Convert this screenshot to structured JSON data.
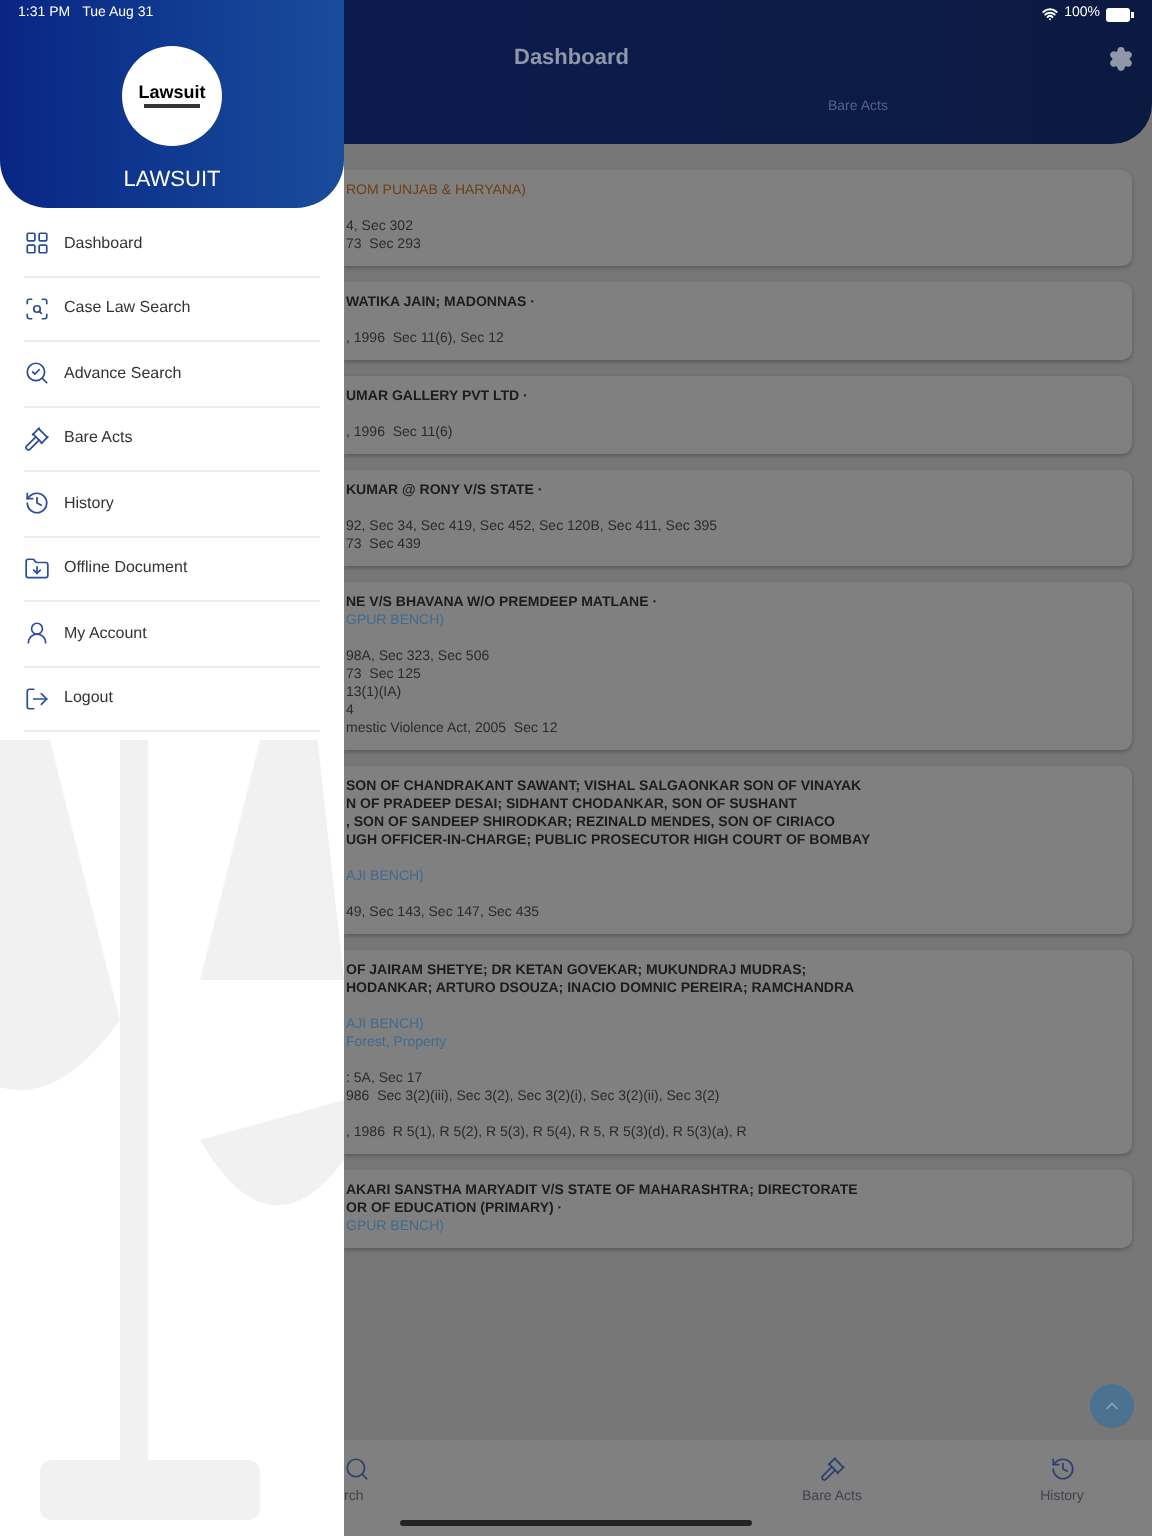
{
  "status_bar": {
    "time": "1:31 PM",
    "date": "Tue Aug 31",
    "battery": "100%"
  },
  "drawer": {
    "app_name": "LAWSUIT",
    "logo_text": "Lawsuit",
    "items": [
      {
        "label": "Dashboard"
      },
      {
        "label": "Case Law Search"
      },
      {
        "label": "Advance Search"
      },
      {
        "label": "Bare Acts"
      },
      {
        "label": "History"
      },
      {
        "label": "Offline Document"
      },
      {
        "label": "My Account"
      },
      {
        "label": "Logout"
      }
    ]
  },
  "header": {
    "title": "Dashboard",
    "tab": "Bare Acts"
  },
  "cards": [
    {
      "groups": [
        [
          {
            "kind": "court",
            "text": "ROM PUNJAB & HARYANA)",
            "color": "#6e4014"
          }
        ],
        [
          {
            "kind": "act",
            "text": "4, Sec 302"
          },
          {
            "kind": "act",
            "text": "73  Sec 293"
          }
        ]
      ]
    },
    {
      "groups": [
        [
          {
            "kind": "party",
            "text": "WATIKA JAIN; MADONNAS ·"
          }
        ],
        [
          {
            "kind": "act",
            "text": ", 1996  Sec 11(6), Sec 12"
          }
        ]
      ]
    },
    {
      "groups": [
        [
          {
            "kind": "party",
            "text": "UMAR GALLERY PVT LTD ·"
          }
        ],
        [
          {
            "kind": "act",
            "text": ", 1996  Sec 11(6)"
          }
        ]
      ]
    },
    {
      "groups": [
        [
          {
            "kind": "party",
            "text": "KUMAR @ RONY V/S STATE ·"
          }
        ],
        [
          {
            "kind": "act",
            "text": "92, Sec 34, Sec 419, Sec 452, Sec 120B, Sec 411, Sec 395"
          },
          {
            "kind": "act",
            "text": "73  Sec 439"
          }
        ]
      ]
    },
    {
      "groups": [
        [
          {
            "kind": "party",
            "text": "NE V/S BHAVANA W/O PREMDEEP MATLANE ·"
          },
          {
            "kind": "court",
            "text": "GPUR BENCH)",
            "color": "#3f6a90"
          }
        ],
        [
          {
            "kind": "act",
            "text": "98A, Sec 323, Sec 506"
          },
          {
            "kind": "act",
            "text": "73  Sec 125"
          },
          {
            "kind": "act",
            "text": "13(1)(IA)"
          },
          {
            "kind": "act",
            "text": "4"
          },
          {
            "kind": "act",
            "text": "mestic Violence Act, 2005  Sec 12"
          }
        ]
      ]
    },
    {
      "groups": [
        [
          {
            "kind": "party",
            "text": "SON OF CHANDRAKANT SAWANT; VISHAL SALGAONKAR SON OF VINAYAK"
          },
          {
            "kind": "party",
            "text": "N OF PRADEEP DESAI; SIDHANT CHODANKAR, SON OF SUSHANT"
          },
          {
            "kind": "party",
            "text": ", SON OF SANDEEP SHIRODKAR; REZINALD MENDES, SON OF CIRIACO"
          },
          {
            "kind": "party",
            "text": "UGH OFFICER-IN-CHARGE; PUBLIC PROSECUTOR HIGH COURT OF BOMBAY"
          }
        ],
        [
          {
            "kind": "court",
            "text": "AJI BENCH)",
            "color": "#3f6a90"
          }
        ],
        [
          {
            "kind": "act",
            "text": "49, Sec 143, Sec 147, Sec 435"
          }
        ]
      ]
    },
    {
      "groups": [
        [
          {
            "kind": "party",
            "text": "OF JAIRAM SHETYE; DR KETAN GOVEKAR; MUKUNDRAJ MUDRAS;"
          },
          {
            "kind": "party",
            "text": "HODANKAR; ARTURO DSOUZA; INACIO DOMNIC PEREIRA; RAMCHANDRA"
          }
        ],
        [
          {
            "kind": "court",
            "text": "AJI BENCH)",
            "color": "#3f6a90"
          },
          {
            "kind": "court",
            "text": "Forest, Property",
            "color": "#3f6a90"
          }
        ],
        [
          {
            "kind": "act",
            "text": ": 5A, Sec 17"
          },
          {
            "kind": "act",
            "text": "986  Sec 3(2)(iii), Sec 3(2), Sec 3(2)(i), Sec 3(2)(ii), Sec 3(2)"
          }
        ],
        [
          {
            "kind": "act",
            "text": ", 1986  R 5(1), R 5(2), R 5(3), R 5(4), R 5, R 5(3)(d), R 5(3)(a), R"
          }
        ]
      ]
    },
    {
      "groups": [
        [
          {
            "kind": "party",
            "text": "AKARI SANSTHA MARYADIT V/S STATE OF MAHARASHTRA; DIRECTORATE"
          },
          {
            "kind": "party",
            "text": "OR OF EDUCATION (PRIMARY) ·"
          },
          {
            "kind": "court",
            "text": "GPUR BENCH)",
            "color": "#3f6a90"
          }
        ]
      ]
    }
  ],
  "bottom_nav": [
    {
      "label": "rch"
    },
    {
      "label": "Bare Acts"
    },
    {
      "label": "History"
    }
  ]
}
